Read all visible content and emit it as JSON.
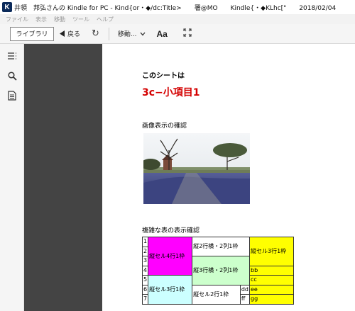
{
  "titlebar": {
    "app_icon": "K",
    "title": "井領　邦弘さんの Kindle for PC - Kind{or・◆/dc:Title>　　署@MO　　Kindle{・◆KLhc[\"　　2018/02/04"
  },
  "menubar": {
    "items": [
      "ファイル",
      "表示",
      "移動",
      "ツール",
      "ヘルプ"
    ]
  },
  "toolbar": {
    "library_label": "ライブラリ",
    "back_label": "戻る",
    "move_label": "移動...",
    "font_label": "Aa"
  },
  "content": {
    "sheet_heading": "このシートは",
    "item_heading": "3c−小項目1",
    "image_caption": "画像表示の確認",
    "table_caption": "複雑な表の表示確認"
  },
  "table": {
    "row_numbers": [
      "1",
      "2",
      "3",
      "4",
      "5",
      "6",
      "7"
    ],
    "magenta": "縦セル4行1枠",
    "top_right_head": "縦2行横・2列1枠",
    "yellow_big": "縦セル3行1枠",
    "green": "縦3行横・2列1枠",
    "bb": "bb",
    "cc": "cc",
    "cyan": "縦セル3行1枠",
    "ee": "ee",
    "bottom_mid": "縦セル2行1枠",
    "dd": "dd",
    "ff": "ff",
    "gg": "gg"
  },
  "colors": {
    "heading_red": "#d40000",
    "magenta": "#ff00ff",
    "yellow": "#ffff00",
    "green": "#ccffcc",
    "cyan": "#ccffff",
    "reader_bg": "#444444"
  }
}
